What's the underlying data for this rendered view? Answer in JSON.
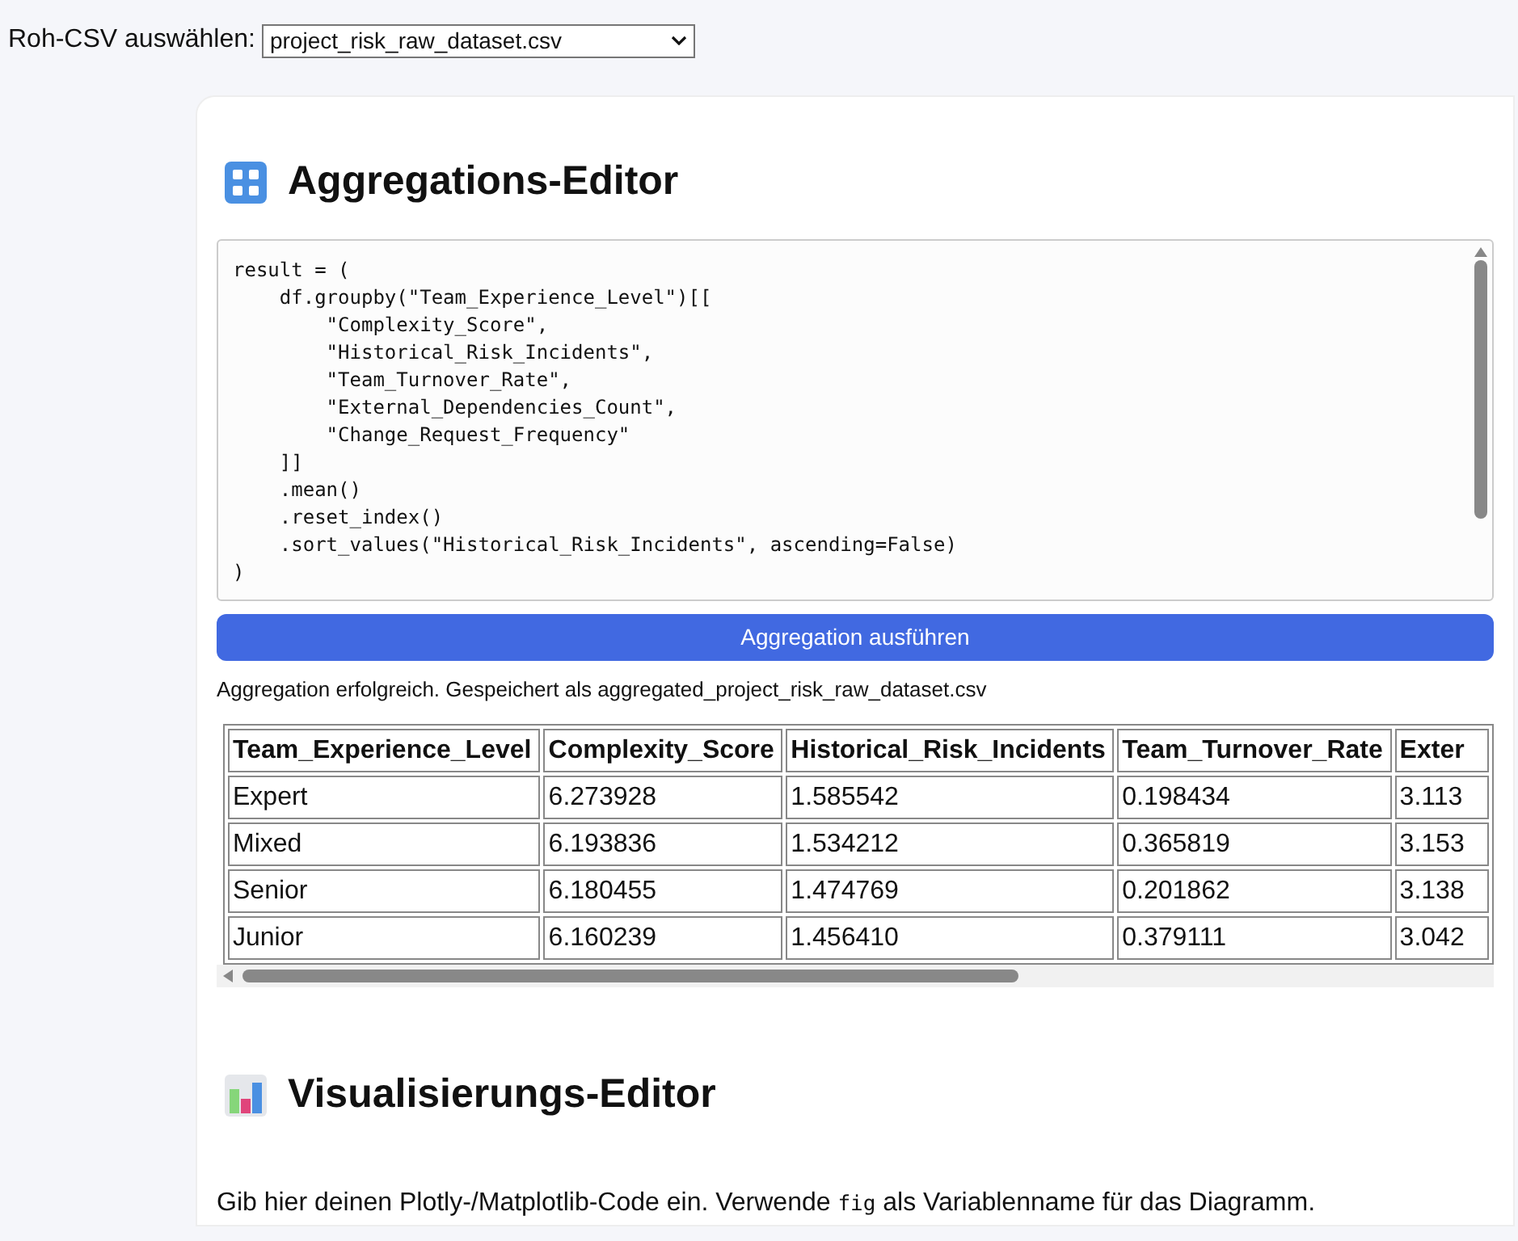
{
  "file_picker": {
    "label": "Roh-CSV auswählen:",
    "value": "project_risk_raw_dataset.csv"
  },
  "aggregation": {
    "title": "Aggregations-Editor",
    "code": "result = (\n    df.groupby(\"Team_Experience_Level\")[[\n        \"Complexity_Score\",\n        \"Historical_Risk_Incidents\",\n        \"Team_Turnover_Rate\",\n        \"External_Dependencies_Count\",\n        \"Change_Request_Frequency\"\n    ]]\n    .mean()\n    .reset_index()\n    .sort_values(\"Historical_Risk_Incidents\", ascending=False)\n)",
    "button": "Aggregation ausführen",
    "status": "Aggregation erfolgreich. Gespeichert als aggregated_project_risk_raw_dataset.csv"
  },
  "table": {
    "columns": [
      "Team_Experience_Level",
      "Complexity_Score",
      "Historical_Risk_Incidents",
      "Team_Turnover_Rate",
      "Exter"
    ],
    "rows": [
      [
        "Expert",
        "6.273928",
        "1.585542",
        "0.198434",
        "3.113"
      ],
      [
        "Mixed",
        "6.193836",
        "1.534212",
        "0.365819",
        "3.153"
      ],
      [
        "Senior",
        "6.180455",
        "1.474769",
        "0.201862",
        "3.138"
      ],
      [
        "Junior",
        "6.160239",
        "1.456410",
        "0.379111",
        "3.042"
      ]
    ]
  },
  "visualization": {
    "title": "Visualisierungs-Editor",
    "hint_before": "Gib hier deinen Plotly-/Matplotlib-Code ein. Verwende ",
    "hint_code": "fig",
    "hint_after": " als Variablenname für das Diagramm."
  }
}
